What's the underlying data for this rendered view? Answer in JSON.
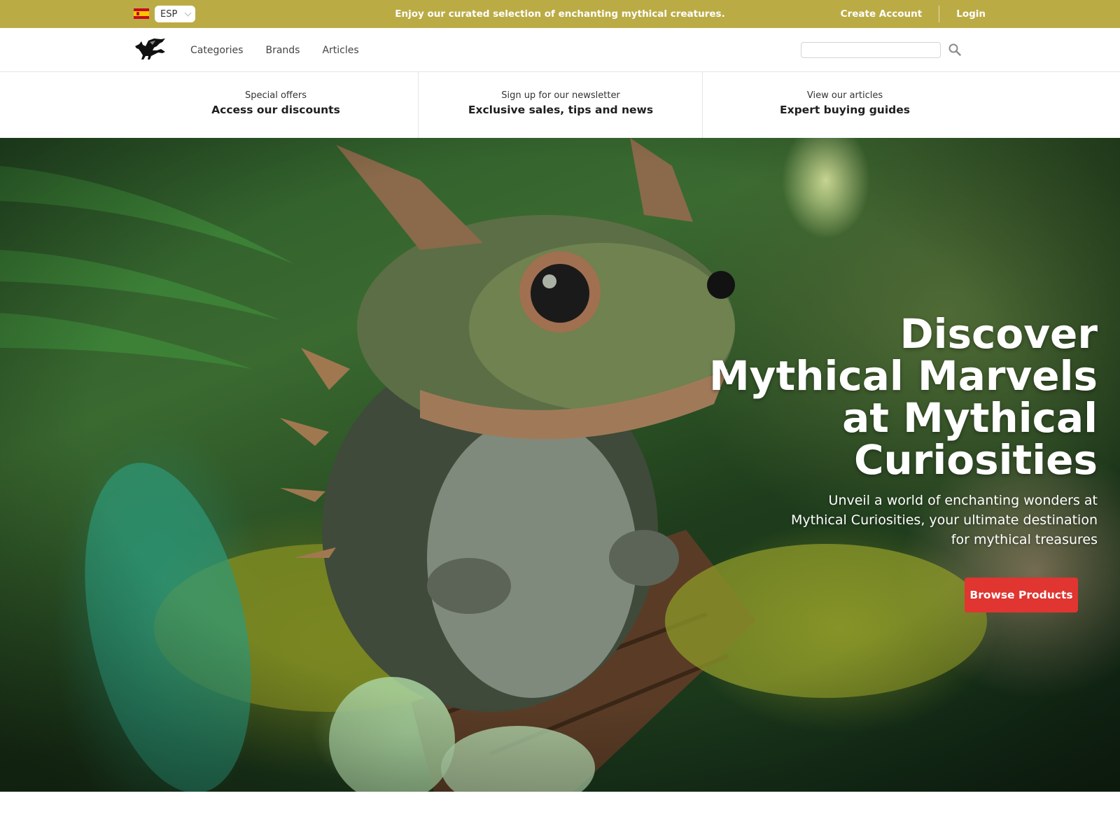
{
  "topbar": {
    "language": {
      "flag": "spain-flag",
      "code": "ESP"
    },
    "promo": "Enjoy our curated selection of enchanting mythical creatures.",
    "create_account": "Create Account",
    "login": "Login",
    "background_color": "#bbab45"
  },
  "nav": {
    "logo": "dragon-logo",
    "links": [
      {
        "label": "Categories"
      },
      {
        "label": "Brands"
      },
      {
        "label": "Articles"
      }
    ],
    "search": {
      "value": "",
      "placeholder": "",
      "icon": "search-icon"
    }
  },
  "features": [
    {
      "subtitle": "Special offers",
      "title": "Access our discounts"
    },
    {
      "subtitle": "Sign up for our newsletter",
      "title": "Exclusive sales, tips and news"
    },
    {
      "subtitle": "View our articles",
      "title": "Expert buying guides"
    }
  ],
  "hero": {
    "title": "Discover Mythical Marvels at Mythical Curiosities",
    "subtitle": "Unveil a world of enchanting wonders at Mythical Curiosities, your ultimate destination for mythical treasures",
    "cta_label": "Browse Products",
    "cta_color": "#e03530",
    "image": "baby-dragon-in-forest-photo"
  }
}
